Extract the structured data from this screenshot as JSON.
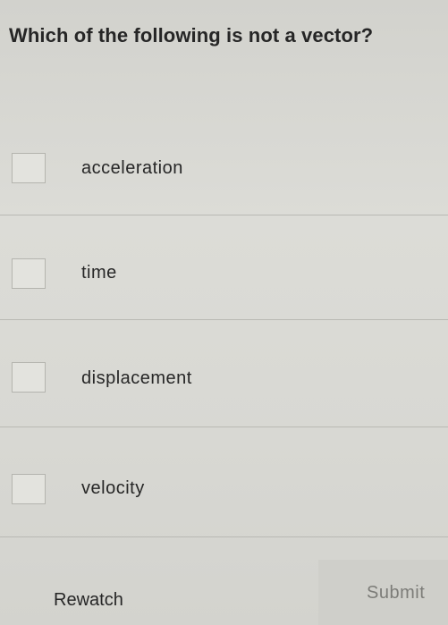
{
  "question": {
    "text": "Which of the following is not a vector?"
  },
  "options": [
    {
      "label": "acceleration",
      "checked": false
    },
    {
      "label": "time",
      "checked": false
    },
    {
      "label": "displacement",
      "checked": false
    },
    {
      "label": "velocity",
      "checked": false
    }
  ],
  "actions": {
    "rewatch_label": "Rewatch",
    "submit_label": "Submit",
    "submit_enabled": false
  }
}
